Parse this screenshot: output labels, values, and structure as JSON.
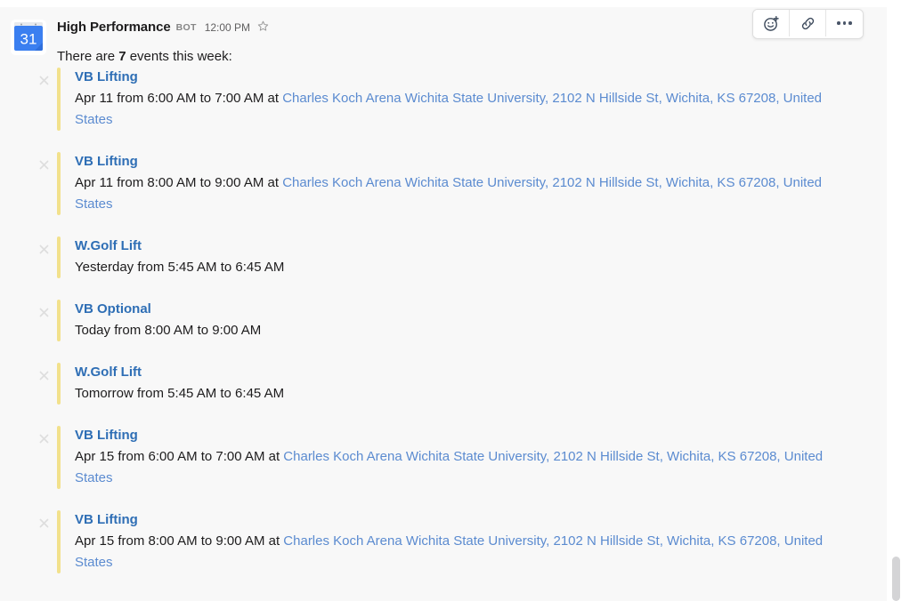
{
  "message": {
    "sender": "High Performance",
    "bot_badge": "BOT",
    "timestamp": "12:00 PM",
    "intro_prefix": "There are ",
    "intro_count": "7",
    "intro_suffix": " events this week:",
    "avatar": {
      "icon": "google-calendar-icon",
      "day_number": "31"
    }
  },
  "toolbar": {
    "add_reaction_label": "add-reaction-icon",
    "share_link_label": "link-icon",
    "more_actions_label": "more-actions-icon",
    "star_label": "star-icon"
  },
  "colors": {
    "hover_background": "#f8f8f8",
    "attachment_bar": "#f2e18c",
    "title_link": "#2e6eb5",
    "location_link": "#5b8bd0",
    "body_text": "#1d1c1d",
    "muted_text": "#616061",
    "scrollbar_thumb": "#d4d4d6"
  },
  "events": [
    {
      "title": "VB Lifting",
      "when": "Apr 11 from 6:00 AM to 7:00 AM at ",
      "location": "Charles Koch Arena Wichita State University, 2102 N Hillside St, Wichita, KS 67208, United States",
      "close_label": "×"
    },
    {
      "title": "VB Lifting",
      "when": "Apr 11 from 8:00 AM to 9:00 AM at ",
      "location": "Charles Koch Arena Wichita State University, 2102 N Hillside St, Wichita, KS 67208, United States",
      "close_label": "×"
    },
    {
      "title": "W.Golf Lift",
      "when": "Yesterday from 5:45 AM to 6:45 AM",
      "location": "",
      "close_label": "×"
    },
    {
      "title": "VB Optional",
      "when": "Today from 8:00 AM to 9:00 AM",
      "location": "",
      "close_label": "×"
    },
    {
      "title": "W.Golf Lift",
      "when": "Tomorrow from 5:45 AM to 6:45 AM",
      "location": "",
      "close_label": "×"
    },
    {
      "title": "VB Lifting",
      "when": "Apr 15 from 6:00 AM to 7:00 AM at ",
      "location": "Charles Koch Arena Wichita State University, 2102 N Hillside St, Wichita, KS 67208, United States",
      "close_label": "×"
    },
    {
      "title": "VB Lifting",
      "when": "Apr 15 from 8:00 AM to 9:00 AM at ",
      "location": "Charles Koch Arena Wichita State University, 2102 N Hillside St, Wichita, KS 67208, United States",
      "close_label": "×"
    }
  ]
}
